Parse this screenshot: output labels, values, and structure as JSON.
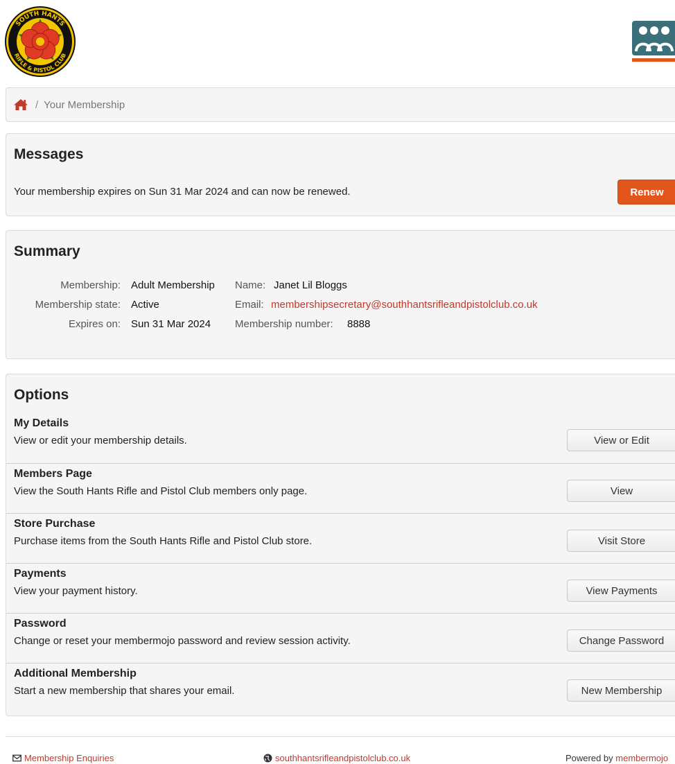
{
  "header": {
    "club_logo_text_top": "SOUTH HANTS",
    "club_logo_text_bottom": "RIFLE & PISTOL CLUB",
    "brand_logo_icon": "membermojo-people-icon",
    "colors": {
      "accent": "#e2561e",
      "link": "#c0392b",
      "logo_red": "#e03a24",
      "logo_yellow": "#f2c500",
      "logo_green": "#2e7d32",
      "brand_teal": "#3b6f7a"
    }
  },
  "breadcrumb": {
    "home_icon": "home-icon",
    "separator": "/",
    "current": "Your Membership"
  },
  "messages": {
    "title": "Messages",
    "text": "Your membership expires on Sun 31 Mar 2024 and can now be renewed.",
    "renew_label": "Renew"
  },
  "summary": {
    "title": "Summary",
    "membership_label": "Membership:",
    "membership_value": "Adult Membership",
    "state_label": "Membership state:",
    "state_value": "Active",
    "expires_label": "Expires on:",
    "expires_value": "Sun 31 Mar 2024",
    "name_label": "Name:",
    "name_value": "Janet Lil Bloggs",
    "email_label": "Email:",
    "email_value": "membershipsecretary@southhantsrifleandpistolclub.co.uk",
    "number_label": "Membership number:",
    "number_value": "8888"
  },
  "options": {
    "title": "Options",
    "items": [
      {
        "title": "My Details",
        "desc": "View or edit your membership details.",
        "button": "View or Edit"
      },
      {
        "title": "Members Page",
        "desc": "View the South Hants Rifle and Pistol Club members only page.",
        "button": "View"
      },
      {
        "title": "Store Purchase",
        "desc": "Purchase items from the South Hants Rifle and Pistol Club store.",
        "button": "Visit Store"
      },
      {
        "title": "Payments",
        "desc": "View your payment history.",
        "button": "View Payments"
      },
      {
        "title": "Password",
        "desc": "Change or reset your membermojo password and review session activity.",
        "button": "Change Password"
      },
      {
        "title": "Additional Membership",
        "desc": "Start a new membership that shares your email.",
        "button": "New Membership"
      }
    ]
  },
  "footer": {
    "enquiries_icon": "envelope-icon",
    "enquiries": "Membership Enquiries",
    "website_icon": "globe-icon",
    "website": "southhantsrifleandpistolclub.co.uk",
    "powered_prefix": "Powered by",
    "powered_link": "membermojo"
  }
}
